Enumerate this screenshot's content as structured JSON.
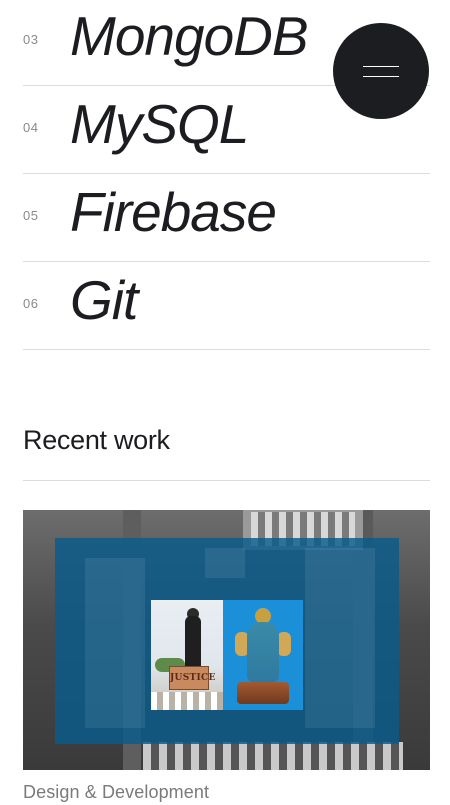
{
  "skills": [
    {
      "number": "03",
      "name": "MongoDB"
    },
    {
      "number": "04",
      "name": "MySQL"
    },
    {
      "number": "05",
      "name": "Firebase"
    },
    {
      "number": "06",
      "name": "Git"
    }
  ],
  "menu": {
    "icon": "hamburger-icon"
  },
  "recent_work": {
    "title": "Recent work",
    "items": [
      {
        "caption": "Design & Development",
        "thumbnail_sign_text": "JUSTICE"
      }
    ]
  },
  "colors": {
    "text": "#1c1d20",
    "muted": "#8a8a8a",
    "divider": "#dcdcdc",
    "menu_bg": "#1c1d20",
    "overlay_blue": "#085c8c"
  }
}
